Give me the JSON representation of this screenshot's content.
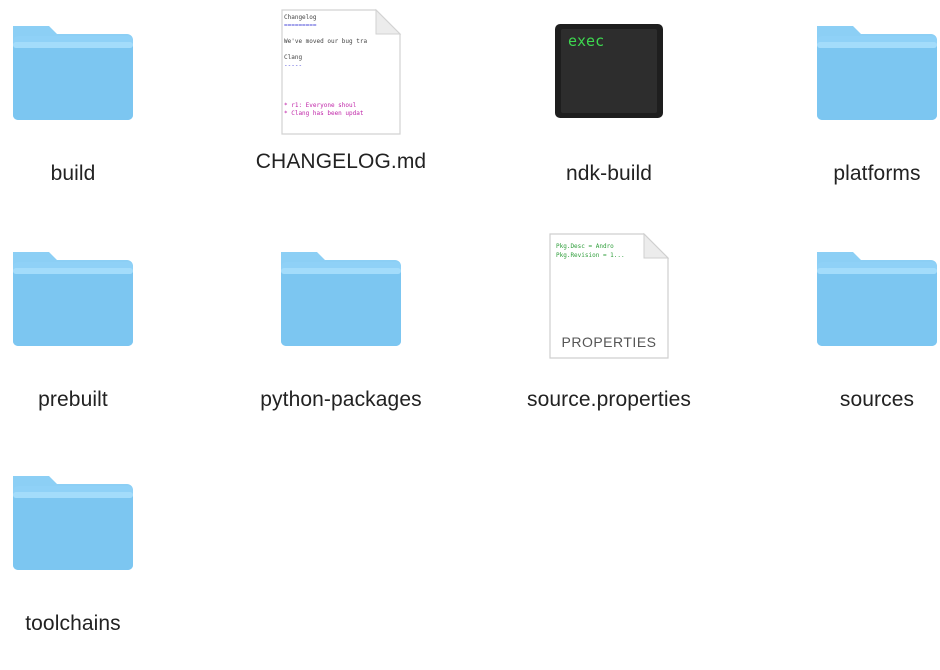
{
  "folder_colors": {
    "tab": "#8ccff5",
    "body_top": "#9ad7fb",
    "body_bottom": "#77c2ef",
    "edge": "#6cb8e6"
  },
  "items": [
    {
      "name": "build",
      "kind": "folder",
      "icon": "folder-icon"
    },
    {
      "name": "CHANGELOG.md",
      "kind": "markdown-file",
      "icon": "document-preview-icon",
      "preview": {
        "line1": "Changelog",
        "line2": "=========",
        "line3": "We've moved our bug tra",
        "line4": "Clang",
        "line5": "-----",
        "line6": "* r1: Everyone shoul",
        "line7": "* Clang has been updat"
      }
    },
    {
      "name": "ndk-build",
      "kind": "executable",
      "icon": "terminal-exec-icon",
      "badge_text": "exec",
      "badge_color": "#3dd84f"
    },
    {
      "name": "platforms",
      "kind": "folder",
      "icon": "folder-icon"
    },
    {
      "name": "prebuilt",
      "kind": "folder",
      "icon": "folder-icon"
    },
    {
      "name": "python-packages",
      "kind": "folder",
      "icon": "folder-icon"
    },
    {
      "name": "source.properties",
      "kind": "properties-file",
      "icon": "properties-document-icon",
      "preview": {
        "line1": "Pkg.Desc = Andro",
        "line2": "Pkg.Revision = 1..."
      },
      "type_label": "PROPERTIES"
    },
    {
      "name": "sources",
      "kind": "folder",
      "icon": "folder-icon"
    },
    {
      "name": "toolchains",
      "kind": "folder",
      "icon": "folder-icon"
    }
  ]
}
